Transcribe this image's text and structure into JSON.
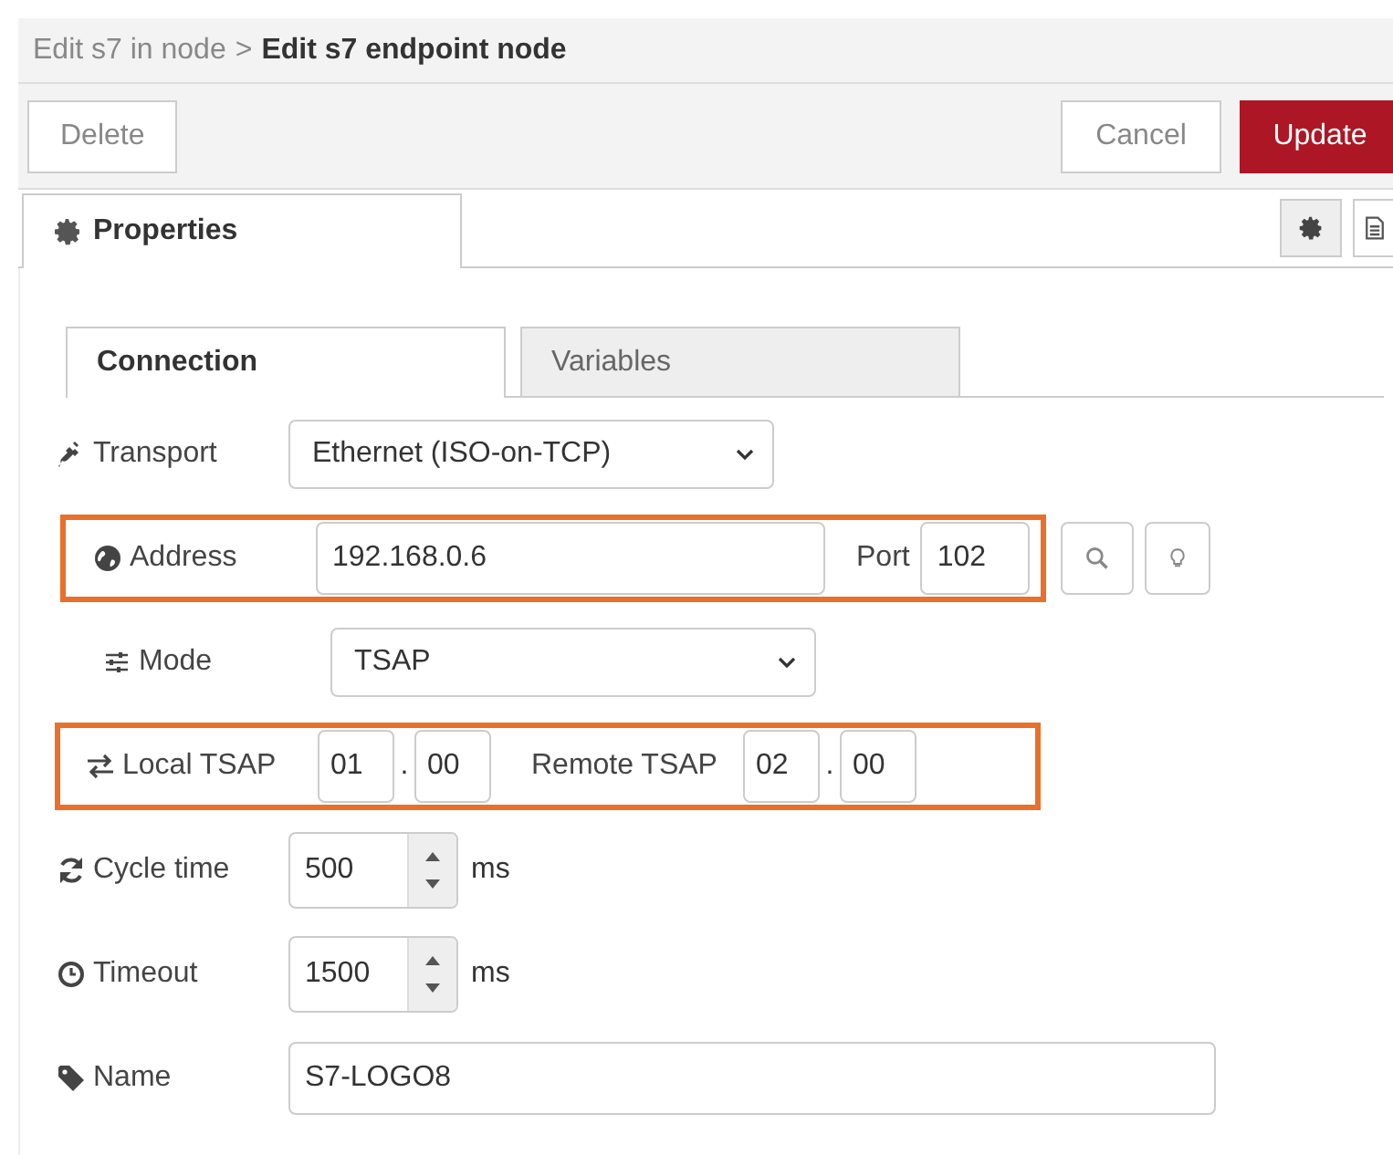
{
  "breadcrumb": {
    "parent": "Edit s7 in node",
    "separator": ">",
    "current": "Edit s7 endpoint node"
  },
  "toolbar": {
    "delete": "Delete",
    "cancel": "Cancel",
    "update": "Update"
  },
  "tabs": [
    {
      "label": "Properties",
      "selected": true
    }
  ],
  "side_buttons": [
    {
      "kind": "gear",
      "selected": true
    },
    {
      "kind": "doc",
      "selected": false
    }
  ],
  "inner_tabs": [
    {
      "label": "Connection",
      "selected": true
    },
    {
      "label": "Variables",
      "selected": false
    }
  ],
  "transport": {
    "label": "Transport",
    "value": "Ethernet (ISO-on-TCP)"
  },
  "address": {
    "label": "Address",
    "value": "192.168.0.6",
    "port_label": "Port",
    "port": "102",
    "highlighted": true
  },
  "mode": {
    "label": "Mode",
    "value": "TSAP"
  },
  "tsap": {
    "local_label": "Local TSAP",
    "local": [
      "01",
      "00"
    ],
    "separator": ".",
    "remote_label": "Remote TSAP",
    "remote": [
      "02",
      "00"
    ],
    "highlighted": true
  },
  "cycle_time": {
    "label": "Cycle time",
    "value": "500",
    "unit": "ms"
  },
  "timeout": {
    "label": "Timeout",
    "value": "1500",
    "unit": "ms"
  },
  "name": {
    "label": "Name",
    "value": "S7-LOGO8"
  }
}
